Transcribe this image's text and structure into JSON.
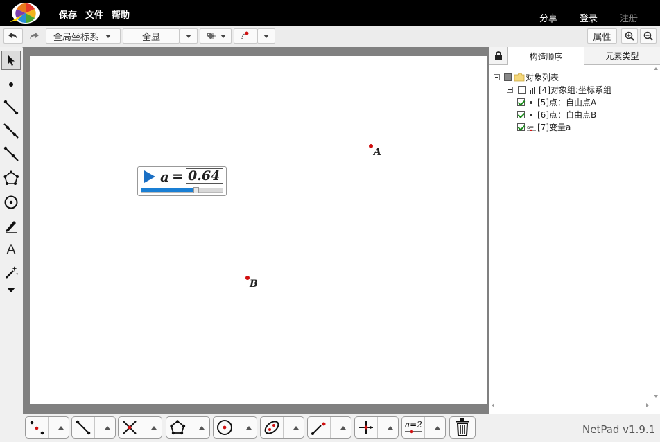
{
  "menu": {
    "save": "保存",
    "file": "文件",
    "help": "帮助",
    "share": "分享",
    "login": "登录",
    "register": "注册"
  },
  "toolbar": {
    "coord_system": "全局坐标系",
    "show_all": "全显",
    "properties": "属性"
  },
  "panel": {
    "tabs": [
      "构造顺序",
      "元素类型"
    ],
    "active_tab": 0,
    "tree": [
      {
        "label": "对象列表",
        "checked": false,
        "expander": "minus",
        "icon": "folder-icon"
      },
      {
        "label": "[4]对象组:坐标系组",
        "checked": false,
        "expander": "plus",
        "icon": "chart-icon"
      },
      {
        "label": "[5]点：自由点A",
        "checked": true,
        "expander": "none",
        "icon": "point-icon"
      },
      {
        "label": "[6]点：自由点B",
        "checked": true,
        "expander": "none",
        "icon": "point-icon"
      },
      {
        "label": "[7]变量a",
        "checked": true,
        "expander": "none",
        "icon": "variable-icon"
      }
    ]
  },
  "canvas": {
    "points": [
      {
        "label": "A"
      },
      {
        "label": "B"
      }
    ],
    "slider": {
      "var_name": "a",
      "equals": "=",
      "value": "0.64",
      "progress": 0.64
    }
  },
  "footer": {
    "version": "NetPad v1.9.1"
  },
  "colors": {
    "point": "#d01010",
    "slider_fill": "#1a7fd4",
    "play": "#1a6fc4",
    "canvas_frame": "#808080"
  }
}
